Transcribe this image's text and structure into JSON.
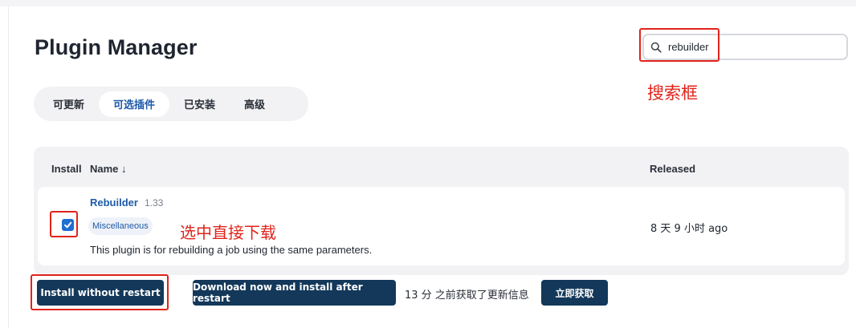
{
  "page": {
    "title": "Plugin Manager"
  },
  "search": {
    "value": "rebuilder",
    "annotation": "搜索框"
  },
  "tabs": [
    {
      "label": "可更新",
      "active": false
    },
    {
      "label": "可选插件",
      "active": true
    },
    {
      "label": "已安装",
      "active": false
    },
    {
      "label": "高级",
      "active": false
    }
  ],
  "table": {
    "headers": {
      "install": "Install",
      "name": "Name ↓",
      "released": "Released"
    },
    "rows": [
      {
        "name": "Rebuilder",
        "version": "1.33",
        "category": "Miscellaneous",
        "description": "This plugin is for rebuilding a job using the same parameters.",
        "released": "8 天 9 小时 ago",
        "checked": true,
        "annotation": "选中直接下载"
      }
    ]
  },
  "actions": {
    "install_now": "Install without restart",
    "download_later": "Download now and install after restart",
    "info": "13 分 之前获取了更新信息",
    "fetch_now": "立即获取"
  },
  "colors": {
    "accent": "#1e5aa8",
    "button": "#13385a",
    "annotation": "#e0241b",
    "checkbox": "#1f6fd1"
  }
}
